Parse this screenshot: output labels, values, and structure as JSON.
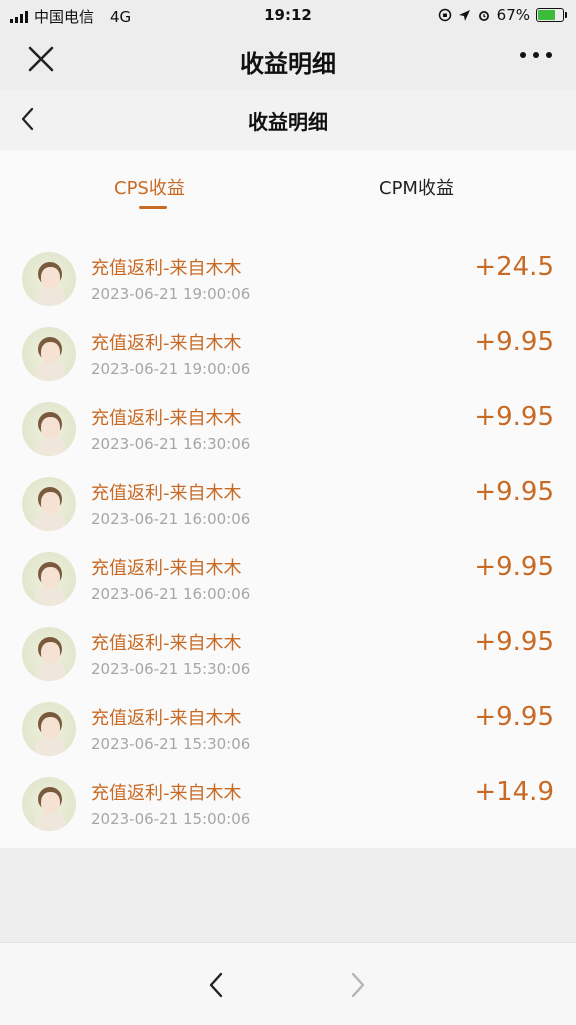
{
  "status_bar": {
    "carrier": "中国电信",
    "network": "4G",
    "time": "19:12",
    "battery": "67%",
    "battery_level": 0.67
  },
  "wx_header": {
    "title": "收益明细"
  },
  "page_nav": {
    "title": "收益明细"
  },
  "tabs": [
    {
      "label": "CPS收益",
      "active": true
    },
    {
      "label": "CPM收益",
      "active": false
    }
  ],
  "records": [
    {
      "title": "充值返利-来自木木",
      "time": "2023-06-21 19:00:06",
      "amount": "+24.5"
    },
    {
      "title": "充值返利-来自木木",
      "time": "2023-06-21 19:00:06",
      "amount": "+9.95"
    },
    {
      "title": "充值返利-来自木木",
      "time": "2023-06-21 16:30:06",
      "amount": "+9.95"
    },
    {
      "title": "充值返利-来自木木",
      "time": "2023-06-21 16:00:06",
      "amount": "+9.95"
    },
    {
      "title": "充值返利-来自木木",
      "time": "2023-06-21 16:00:06",
      "amount": "+9.95"
    },
    {
      "title": "充值返利-来自木木",
      "time": "2023-06-21 15:30:06",
      "amount": "+9.95"
    },
    {
      "title": "充值返利-来自木木",
      "time": "2023-06-21 15:30:06",
      "amount": "+9.95"
    },
    {
      "title": "充值返利-来自木木",
      "time": "2023-06-21 15:00:06",
      "amount": "+14.9"
    }
  ],
  "colors": {
    "accent": "#c86a24",
    "muted": "#a6a6a6",
    "battery": "#3bbd3b"
  },
  "icons": {
    "close": "close-icon",
    "more": "more-icon",
    "back": "chevron-left-icon",
    "forward": "chevron-right-icon"
  }
}
